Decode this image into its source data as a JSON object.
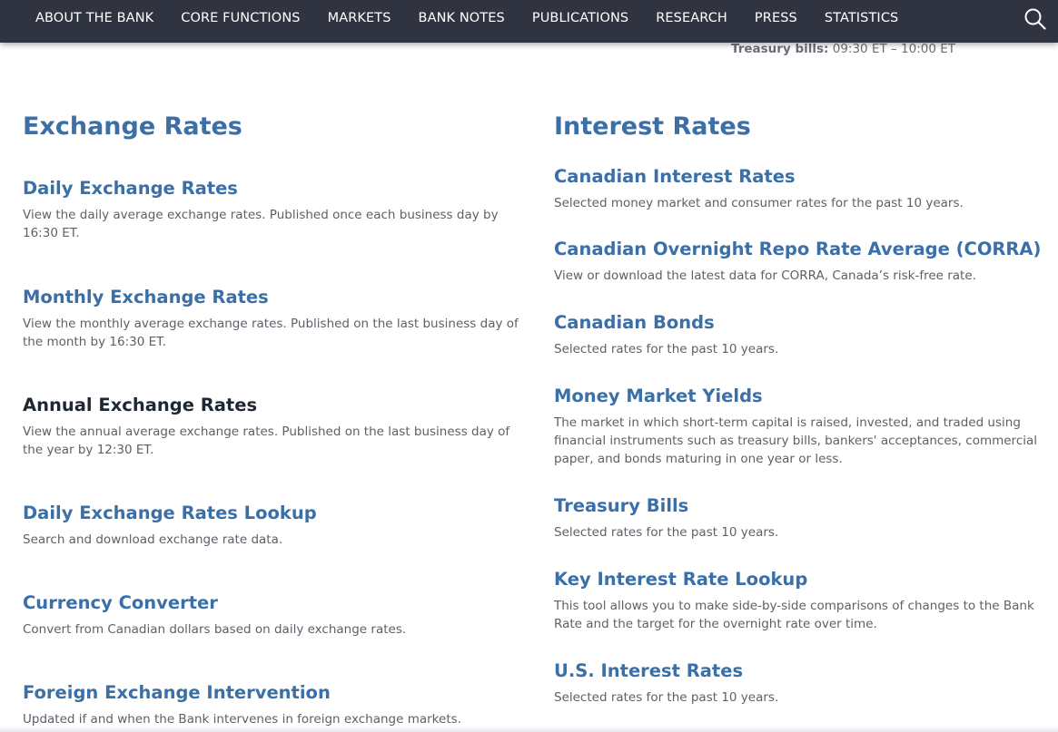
{
  "nav": {
    "items": [
      "ABOUT THE BANK",
      "CORE FUNCTIONS",
      "MARKETS",
      "BANK NOTES",
      "PUBLICATIONS",
      "RESEARCH",
      "PRESS",
      "STATISTICS"
    ],
    "search_icon": "search-icon"
  },
  "auction": {
    "label": "Treasury bills:",
    "time": " 09:30 ET – 10:00 ET"
  },
  "exchange": {
    "heading": "Exchange Rates",
    "items": [
      {
        "title": "Daily Exchange Rates",
        "desc": "View the daily average exchange rates. Published once each business day by 16:30 ET."
      },
      {
        "title": "Monthly Exchange Rates",
        "desc": "View the monthly average exchange rates. Published on the last business day of the month by 16:30 ET."
      },
      {
        "title": "Annual Exchange Rates",
        "desc": "View the annual average exchange rates. Published on the last business day of the year by 12:30 ET."
      },
      {
        "title": "Daily Exchange Rates Lookup",
        "desc": "Search and download exchange rate data."
      },
      {
        "title": "Currency Converter",
        "desc": "Convert from Canadian dollars based on daily exchange rates."
      },
      {
        "title": "Foreign Exchange Intervention",
        "desc": "Updated if and when the Bank intervenes in foreign exchange markets."
      }
    ]
  },
  "interest": {
    "heading": "Interest Rates",
    "items": [
      {
        "title": "Canadian Interest Rates",
        "desc": "Selected money market and consumer rates for the past 10 years."
      },
      {
        "title": "Canadian Overnight Repo Rate Average (CORRA)",
        "desc": "View or download the latest data for CORRA, Canada’s risk-free rate."
      },
      {
        "title": "Canadian Bonds",
        "desc": "Selected rates for the past 10 years."
      },
      {
        "title": "Money Market Yields",
        "desc": "The market in which short-term capital is raised, invested, and traded using financial instruments such as treasury bills, bankers' acceptances, commercial paper, and bonds maturing in one year or less."
      },
      {
        "title": "Treasury Bills",
        "desc": "Selected rates for the past 10 years."
      },
      {
        "title": "Key Interest Rate Lookup",
        "desc": "This tool allows you to make side-by-side comparisons of changes to the Bank Rate and the target for the overnight rate over time."
      },
      {
        "title": "U.S. Interest Rates",
        "desc": "Selected rates for the past 10 years."
      }
    ]
  },
  "colors": {
    "nav_bg": "#2f3440",
    "link": "#3a6fa8",
    "link_visited_hover": "#1f2733",
    "body_text": "#5c6168"
  }
}
